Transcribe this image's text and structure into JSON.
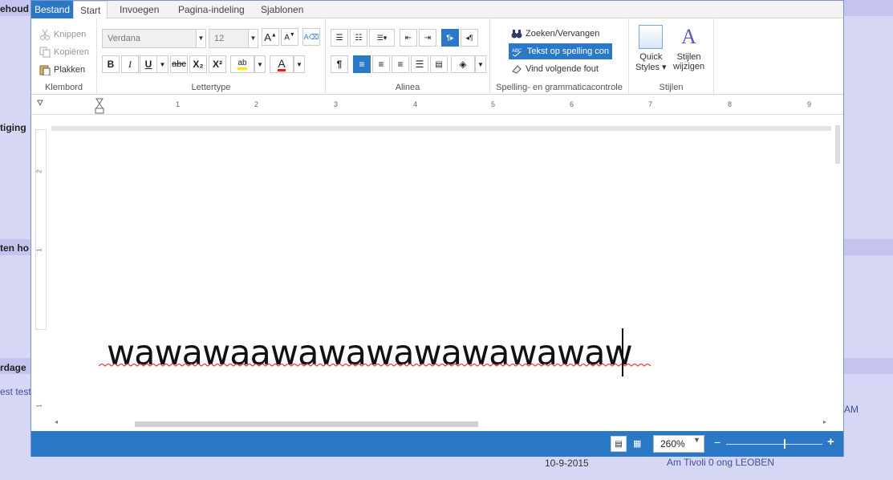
{
  "background": {
    "rows": [
      {
        "label": "ehoud"
      },
      {
        "label": "tiging"
      },
      {
        "label": "ten ho"
      },
      {
        "label": "rdage"
      }
    ],
    "link_left": "est test",
    "date": "10-9-2015",
    "address": "Am Tivoli 0 ong LEOBEN",
    "right_fragment": "AM"
  },
  "tabs": [
    {
      "label": "Bestand"
    },
    {
      "label": "Start"
    },
    {
      "label": "Invoegen"
    },
    {
      "label": "Pagina-indeling"
    },
    {
      "label": "Sjablonen"
    }
  ],
  "ribbon": {
    "clipboard": {
      "label": "Klembord",
      "cut": "Knippen",
      "copy": "Kopiëren",
      "paste": "Plakken"
    },
    "font": {
      "label": "Lettertype",
      "family": "Verdana",
      "size": "12",
      "bold": "B",
      "italic": "I",
      "underline": "U",
      "strike": "abc",
      "sub": "X₂",
      "sup": "X²",
      "highlight": "ab",
      "color": "A"
    },
    "paragraph": {
      "label": "Alinea",
      "pilcrow": "¶"
    },
    "spelling": {
      "label": "Spelling- en grammaticacontrole",
      "find": "Zoeken/Vervangen",
      "check": "Tekst op spelling con",
      "next": "Vind volgende fout"
    },
    "styles": {
      "label": "Stijlen",
      "quick": "Quick",
      "quick2": "Styles",
      "change": "Stijlen",
      "change2": "wijzigen"
    }
  },
  "ruler": {
    "numbers": [
      "1",
      "2",
      "3",
      "4",
      "5",
      "6",
      "7",
      "8",
      "9"
    ],
    "vnumbers": [
      "2",
      "1",
      "1"
    ]
  },
  "document": {
    "text": "wawawaawawawawawawawaw"
  },
  "status": {
    "zoom": "260%",
    "zoom_out": "−",
    "zoom_in": "+"
  },
  "colors": {
    "accent": "#2b79c6",
    "background_app": "#d6d6f5",
    "squiggle": "#e23a3a"
  }
}
